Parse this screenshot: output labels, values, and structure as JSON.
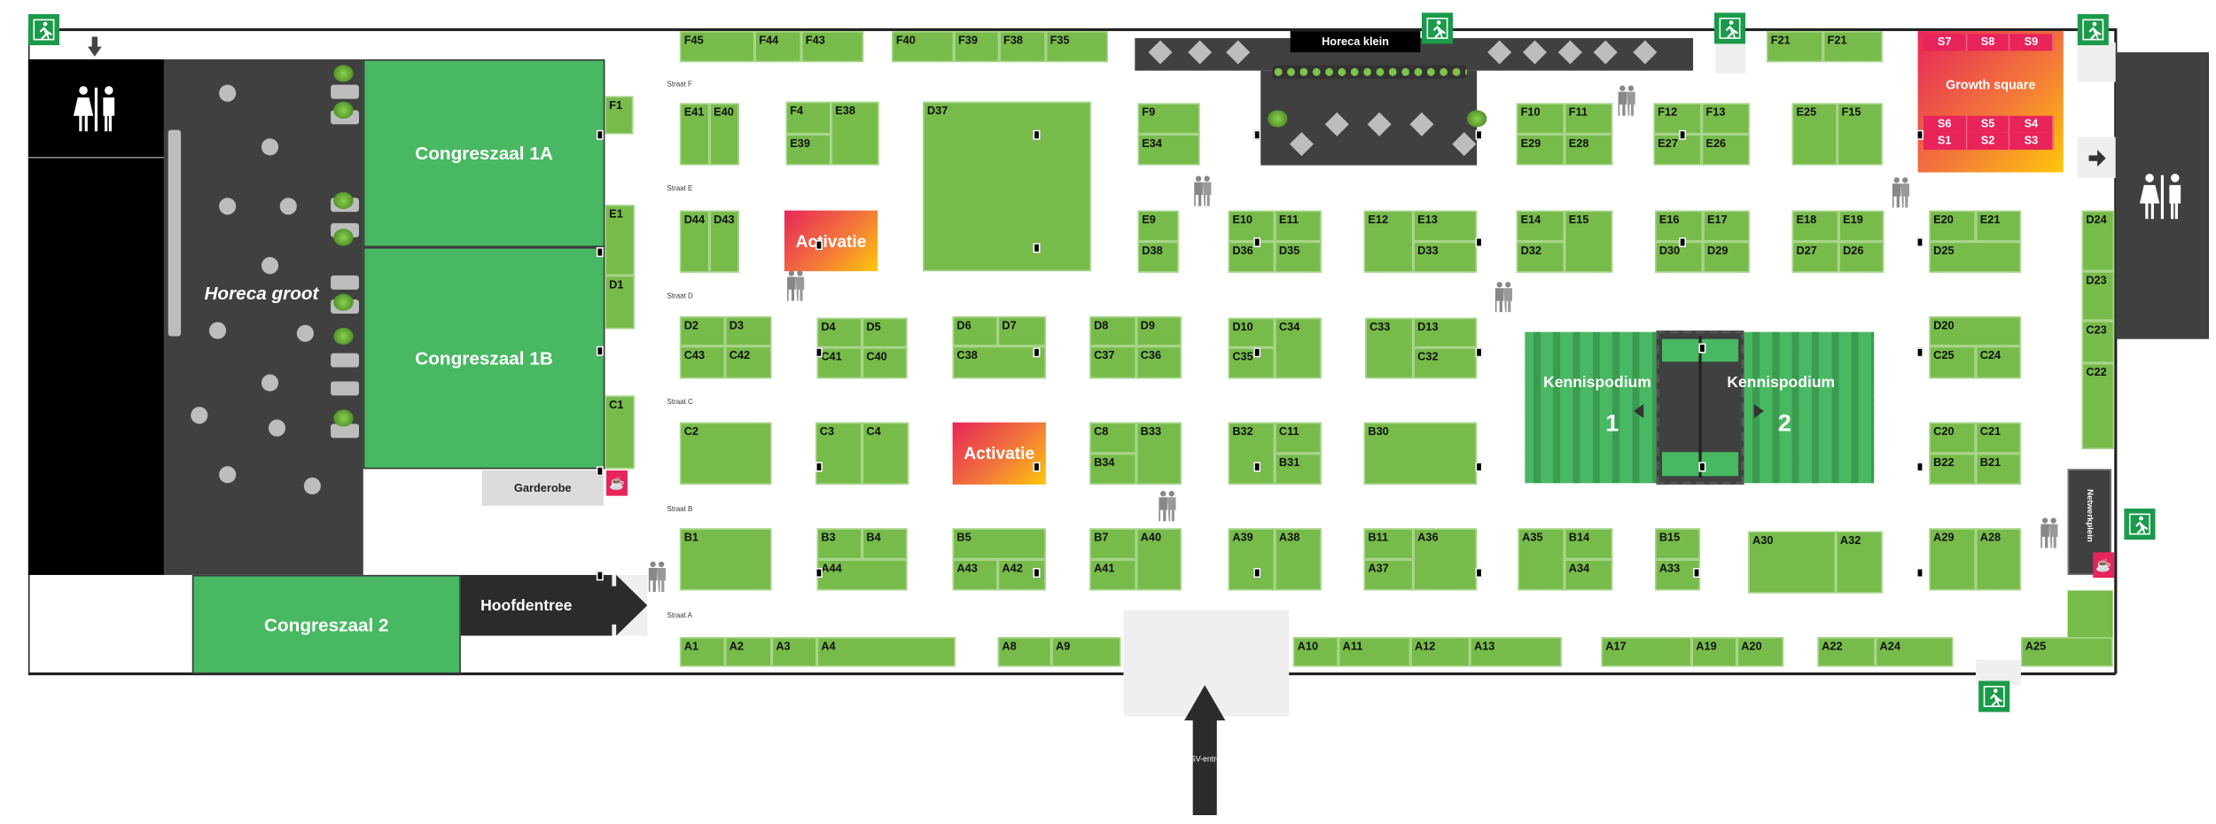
{
  "colors": {
    "booth": "#77bb4b",
    "hall": "#48b862",
    "dark": "#404040",
    "exit": "#1a9a4a",
    "accent_pink": "#e8245a",
    "accent_orange": "#f7931e",
    "accent_yellow": "#ffc80a"
  },
  "areas": {
    "congreszaal_1a": "Congreszaal 1A",
    "congreszaal_1b": "Congreszaal 1B",
    "congreszaal_2": "Congreszaal 2",
    "horeca_groot": "Horeca groot",
    "horeca_klein": "Horeca klein",
    "growth_square": "Growth square",
    "growth_square_seats": [
      "S7",
      "S8",
      "S9",
      "S6",
      "S5",
      "S4",
      "S1",
      "S2",
      "S3"
    ],
    "activatie_1": "Activatie",
    "activatie_2": "Activatie",
    "kennispodium_1": "Kennispodium",
    "kennispodium_1_num": "1",
    "kennispodium_2": "Kennispodium",
    "kennispodium_2_num": "2",
    "garderobe": "Garderobe",
    "hoofdentree": "Hoofdentree",
    "nsv_entree": "NSV-entree",
    "netwerkplein": "Netwerkplein"
  },
  "streets": [
    "Straat F",
    "Straat E",
    "Straat D",
    "Straat C",
    "Straat B",
    "Straat A"
  ],
  "icons": {
    "exit": "emergency-exit-icon",
    "restroom": "restroom-icon",
    "person": "people-icon",
    "coffee": "coffee-icon",
    "arrow": "arrow-icon",
    "stand_marker": "stand-marker-icon"
  },
  "booths": [
    "F45",
    "F44",
    "F43",
    "F40",
    "F39",
    "F38",
    "F35",
    "F21",
    "F21",
    "E41",
    "E40",
    "F4",
    "E39",
    "E38",
    "D37",
    "F9",
    "E34",
    "F10",
    "F11",
    "E29",
    "E28",
    "F12",
    "F13",
    "E27",
    "E26",
    "E25",
    "F15",
    "D44",
    "D43",
    "E9",
    "D38",
    "E10",
    "E11",
    "D36",
    "D35",
    "E12",
    "E13",
    "D33",
    "E14",
    "D32",
    "E15",
    "E16",
    "E17",
    "D30",
    "D29",
    "E18",
    "E19",
    "D27",
    "D26",
    "E20",
    "E21",
    "D25",
    "D24",
    "D23",
    "C23",
    "C22",
    "D2",
    "D3",
    "C43",
    "C42",
    "D4",
    "D5",
    "C41",
    "C40",
    "D6",
    "D7",
    "C38",
    "D8",
    "D9",
    "C37",
    "C36",
    "D10",
    "C35",
    "C34",
    "C33",
    "D13",
    "C32",
    "D20",
    "C25",
    "C24",
    "C2",
    "C3",
    "C4",
    "C8",
    "B34",
    "B33",
    "B32",
    "C11",
    "B31",
    "B30",
    "C20",
    "C21",
    "B22",
    "B21",
    "B1",
    "B3",
    "B4",
    "A44",
    "B5",
    "A43",
    "A42",
    "B7",
    "A41",
    "A40",
    "A39",
    "A38",
    "B11",
    "A37",
    "A36",
    "A35",
    "B14",
    "A34",
    "B15",
    "A33",
    "A30",
    "A32",
    "A29",
    "A28",
    "A1",
    "A2",
    "A3",
    "A4",
    "A8",
    "A9",
    "A10",
    "A11",
    "A12",
    "A13",
    "A17",
    "A19",
    "A20",
    "A22",
    "A24",
    "A25",
    "F1",
    "E1",
    "D1",
    "C1"
  ]
}
